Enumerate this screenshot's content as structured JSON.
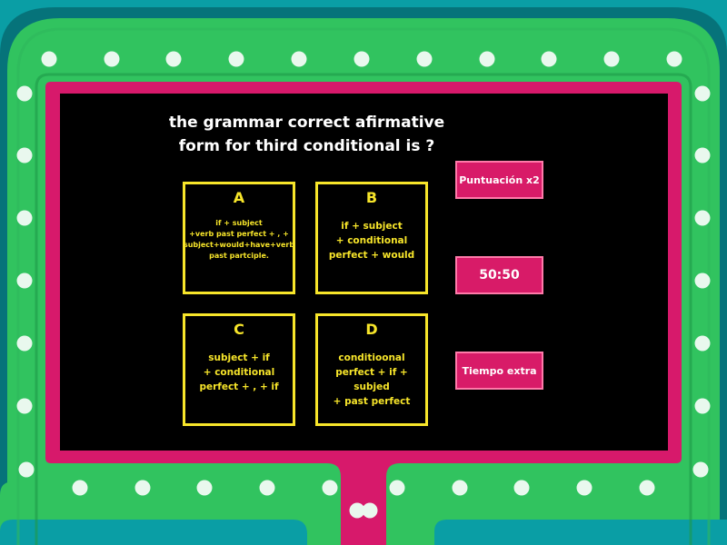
{
  "question": {
    "line1": "the grammar correct afirmative",
    "line2": "form for third conditional is ?"
  },
  "answers": [
    {
      "letter": "A",
      "lines": [
        "if + subject",
        "+verb past perfect + , +",
        "subject+would+have+verb",
        "past partciple."
      ]
    },
    {
      "letter": "B",
      "lines": [
        "if + subject",
        "+ conditional",
        "perfect + would"
      ]
    },
    {
      "letter": "C",
      "lines": [
        "subject + if",
        "+ conditional",
        "perfect + , + if"
      ]
    },
    {
      "letter": "D",
      "lines": [
        "conditioonal",
        "perfect + if + subjed",
        "+ past perfect"
      ]
    }
  ],
  "powerups": {
    "double_score": "Puntuación x2",
    "fifty_fifty": "50:50",
    "extra_time": "Tiempo extra"
  },
  "colors": {
    "frame_green": "#31c35f",
    "frame_teal": "#0a9ea5",
    "inner_pink": "#d7196b",
    "screen": "#000000",
    "accent_yellow": "#f7e52a",
    "button_pink": "#d81b68"
  }
}
